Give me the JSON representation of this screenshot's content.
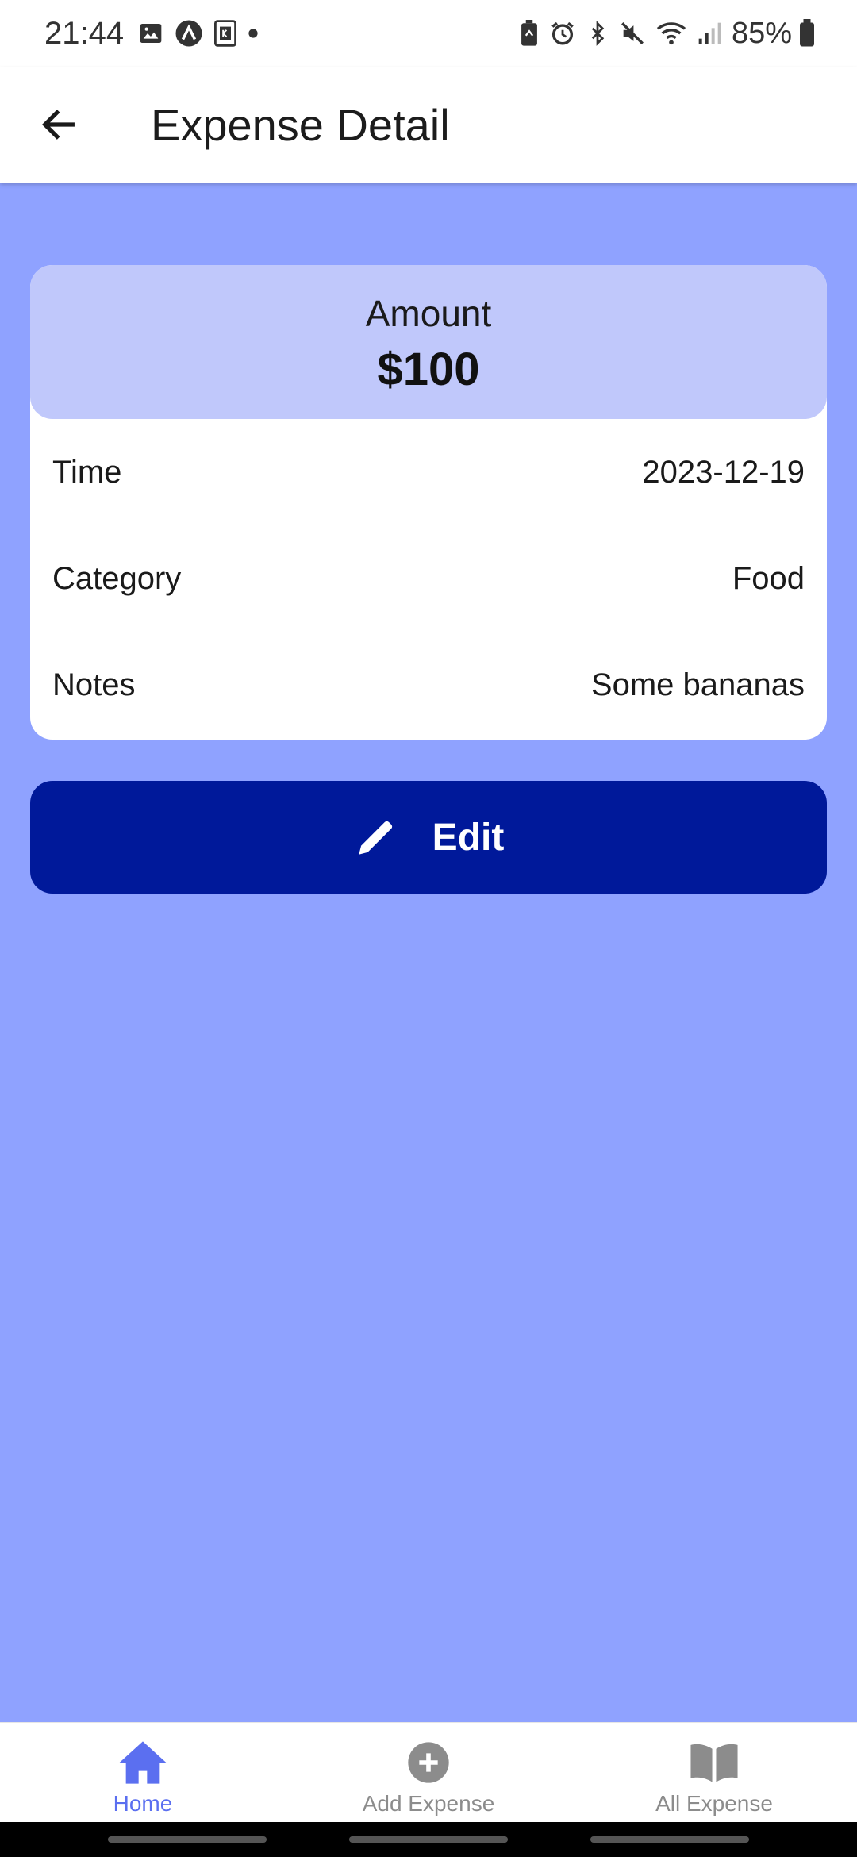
{
  "status_bar": {
    "time": "21:44",
    "battery": "85%",
    "left_icons": [
      "gallery-icon",
      "app-a-icon",
      "app-k-icon",
      "dot-icon"
    ],
    "right_icons": [
      "battery-saver-icon",
      "alarm-icon",
      "bluetooth-icon",
      "mute-icon",
      "wifi-icon",
      "signal-icon",
      "battery-icon"
    ]
  },
  "app_bar": {
    "title": "Expense Detail",
    "back_icon": "arrow-left-icon"
  },
  "detail": {
    "amount_label": "Amount",
    "amount_value": "$100",
    "rows": [
      {
        "label": "Time",
        "value": "2023-12-19"
      },
      {
        "label": "Category",
        "value": "Food"
      },
      {
        "label": "Notes",
        "value": "Some bananas"
      }
    ]
  },
  "edit_button": {
    "label": "Edit",
    "icon": "pencil-icon"
  },
  "bottom_nav": {
    "items": [
      {
        "label": "Home",
        "icon": "home-icon",
        "active": true
      },
      {
        "label": "Add Expense",
        "icon": "add-circle-icon",
        "active": false
      },
      {
        "label": "All Expense",
        "icon": "book-icon",
        "active": false
      }
    ]
  },
  "colors": {
    "background": "#8fa2ff",
    "amount_header": "#c0c8fb",
    "edit_button": "#00199a",
    "nav_active": "#5b6ff0",
    "nav_inactive": "#8c8c8c"
  }
}
